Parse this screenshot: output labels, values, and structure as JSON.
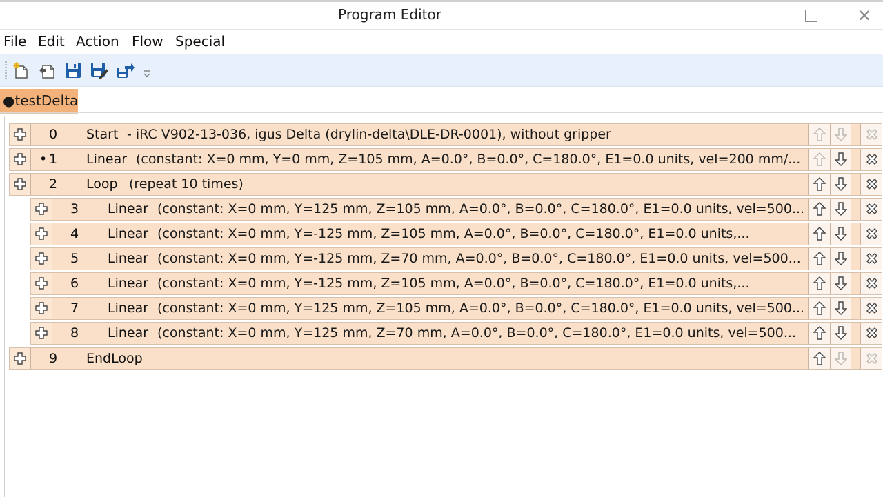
{
  "window": {
    "title": "Program Editor"
  },
  "menu": [
    "File",
    "Edit",
    "Action",
    "Flow",
    "Special"
  ],
  "toolbar": {
    "icons": [
      "new-program-icon",
      "open-icon",
      "save-icon",
      "save-as-icon",
      "upload-icon"
    ]
  },
  "tab": {
    "label": "●testDelta"
  },
  "rows": [
    {
      "number": "0",
      "marker": "",
      "command": "Start",
      "params": "- iRC V902-13-036, igus Delta (drylin-delta\\DLE-DR-0001), without gripper"
    },
    {
      "number": "1",
      "marker": "•",
      "command": "Linear",
      "params": "(constant: X=0 mm, Y=0 mm, Z=105 mm, A=0.0°, B=0.0°, C=180.0°, E1=0.0 units, vel=200 mm/..."
    },
    {
      "number": "2",
      "marker": "",
      "command": "Loop",
      "params": "(repeat 10 times)"
    },
    {
      "number": "3",
      "marker": "",
      "command": "Linear",
      "params": "(constant: X=0 mm, Y=125 mm, Z=105 mm, A=0.0°, B=0.0°, C=180.0°, E1=0.0 units, vel=500..."
    },
    {
      "number": "4",
      "marker": "",
      "command": "Linear",
      "params": "(constant: X=0 mm, Y=-125 mm, Z=105 mm, A=0.0°, B=0.0°, C=180.0°, E1=0.0 units,..."
    },
    {
      "number": "5",
      "marker": "",
      "command": "Linear",
      "params": "(constant: X=0 mm, Y=-125 mm, Z=70 mm, A=0.0°, B=0.0°, C=180.0°, E1=0.0 units, vel=500..."
    },
    {
      "number": "6",
      "marker": "",
      "command": "Linear",
      "params": "(constant: X=0 mm, Y=-125 mm, Z=105 mm, A=0.0°, B=0.0°, C=180.0°, E1=0.0 units,..."
    },
    {
      "number": "7",
      "marker": "",
      "command": "Linear",
      "params": "(constant: X=0 mm, Y=125 mm, Z=105 mm, A=0.0°, B=0.0°, C=180.0°, E1=0.0 units, vel=500..."
    },
    {
      "number": "8",
      "marker": "",
      "command": "Linear",
      "params": "(constant: X=0 mm, Y=125 mm, Z=70 mm, A=0.0°, B=0.0°, C=180.0°, E1=0.0 units, vel=500..."
    },
    {
      "number": "9",
      "marker": "",
      "command": "EndLoop",
      "params": ""
    }
  ],
  "colors": {
    "row_bg": "#fae0c8",
    "tab_bg": "#f2b27a",
    "toolbar_bg": "#e8f1fb",
    "icon_blue": "#1f5fa8"
  }
}
